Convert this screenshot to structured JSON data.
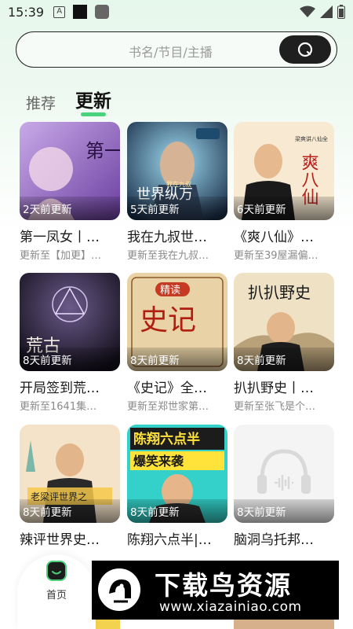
{
  "status_bar": {
    "time": "15:39",
    "icons": [
      "a-icon",
      "black-square-icon",
      "gray-square-icon",
      "wifi-icon",
      "signal-icon",
      "battery-icon"
    ]
  },
  "search": {
    "placeholder": "书名/节目/主播",
    "button_icon": "search-icon"
  },
  "tabs": [
    {
      "label": "推荐",
      "active": false
    },
    {
      "label": "更新",
      "active": true
    }
  ],
  "cards": [
    {
      "badge": "2天前更新",
      "title": "第一凤女丨…",
      "subtitle": "更新至【加更】…",
      "cover_text": "第一凤女"
    },
    {
      "badge": "5天前更新",
      "title": "我在九叔世…",
      "subtitle": "更新至我在九叔…",
      "cover_text": "世界纵万",
      "cover_tag": "我在九叔"
    },
    {
      "badge": "6天前更新",
      "title": "《爽八仙》…",
      "subtitle": "更新至39屋漏偏…",
      "cover_text": "爽八仙",
      "cover_tag": "梁爽讲八仙全"
    },
    {
      "badge": "8天前更新",
      "title": "开局签到荒…",
      "subtitle": "更新至1641集…",
      "cover_text": "荒古"
    },
    {
      "badge": "8天前更新",
      "title": "《史记》全…",
      "subtitle": "更新至郑世家第…",
      "cover_text": "史记",
      "cover_tag": "精读"
    },
    {
      "badge": "8天前更新",
      "title": "扒扒野史丨…",
      "subtitle": "更新至张飞是个…",
      "cover_text": "扒扒野史"
    },
    {
      "badge": "8天前更新",
      "title": "辣评世界史…",
      "subtitle": "",
      "cover_text": "老梁评世界之"
    },
    {
      "badge": "8天前更新",
      "title": "陈翔六点半|…",
      "subtitle": "",
      "cover_text": "陈翔六点半",
      "cover_tag": "爆笑来袭"
    },
    {
      "badge": "8天前更新",
      "title": "脑洞乌托邦…",
      "subtitle": "",
      "cover_icon": "headphones-icon"
    }
  ],
  "bottom_nav": {
    "home_label": "首页",
    "home_icon": "home-icon"
  },
  "watermark": {
    "title": "下载鸟资源",
    "url": "www.xiazainiao.com"
  },
  "colors": {
    "accent": "#48d37c",
    "dark": "#1f1f1f"
  }
}
